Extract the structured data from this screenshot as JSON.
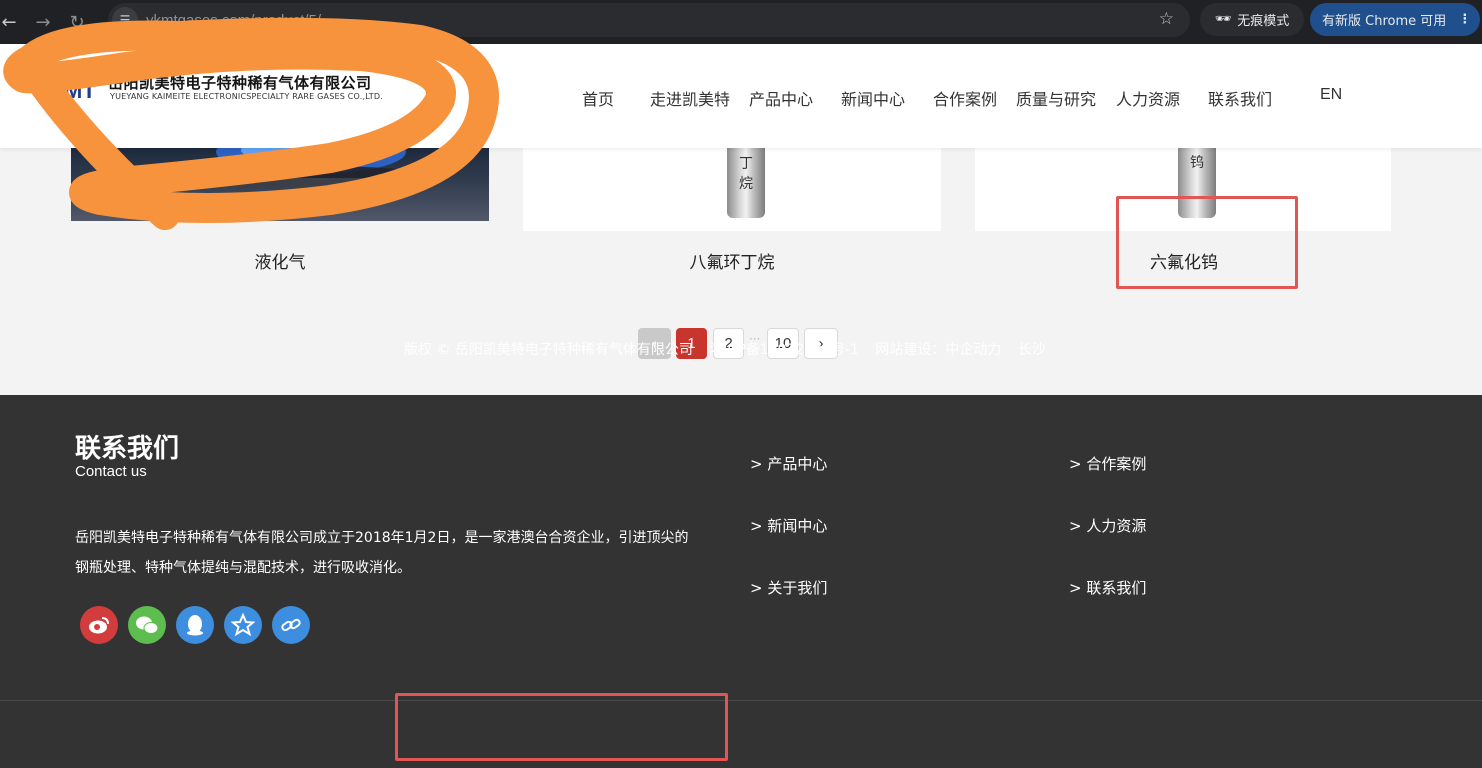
{
  "browser": {
    "url": "ykmtgases.com/product/5/",
    "incognito_label": "无痕模式",
    "update_label": "有新版 Chrome 可用"
  },
  "header": {
    "logo_mark": "MT",
    "logo_cn": "岳阳凯美特电子特种稀有气体有限公司",
    "logo_en": "YUEYANG KAIMEITE ELECTRONICSPECIALTY RARE GASES CO.,LTD.",
    "nav": [
      "首页",
      "走进凯美特",
      "产品中心",
      "新闻中心",
      "合作案例",
      "质量与研究",
      "人力资源",
      "联系我们",
      "EN"
    ]
  },
  "products": [
    {
      "name": "液化气",
      "cylinder_text": ""
    },
    {
      "name": "八氟环丁烷",
      "cylinder_text": "丁\n烷"
    },
    {
      "name": "六氟化钨",
      "cylinder_text": "钨"
    }
  ],
  "pagination": {
    "prev": "‹",
    "pages": [
      "1",
      "2"
    ],
    "ellipsis": "···",
    "last": "10",
    "next": "›",
    "current": 1
  },
  "footer": {
    "contact_title": "联系我们",
    "contact_sub": "Contact us",
    "about_line1": "岳阳凯美特电子特种稀有气体有限公司成立于2018年1月2日，是一家港澳台合资企业，引进顶尖的",
    "about_line2": "钢瓶处理、特种气体提纯与混配技术，进行吸收消化。",
    "socials": [
      "weibo-icon",
      "wechat-icon",
      "qq-icon",
      "qzone-icon",
      "link-icon"
    ],
    "links_col1": [
      ">  产品中心",
      ">   新闻中心",
      ">   关于我们"
    ],
    "links_col2": [
      ">  合作案例",
      ">  人力资源",
      ">  联系我们"
    ],
    "copyright": "版权 © 岳阳凯美特电子特种稀有气体有限公司",
    "icp": "湘ICP备19022394号-1",
    "builder": "网站建设：中企动力",
    "city": "长沙"
  },
  "colors": {
    "annotation_orange": "#f7923d",
    "annotation_red": "#e25555",
    "active_page": "#c8352d",
    "footer_bg": "#333333"
  }
}
